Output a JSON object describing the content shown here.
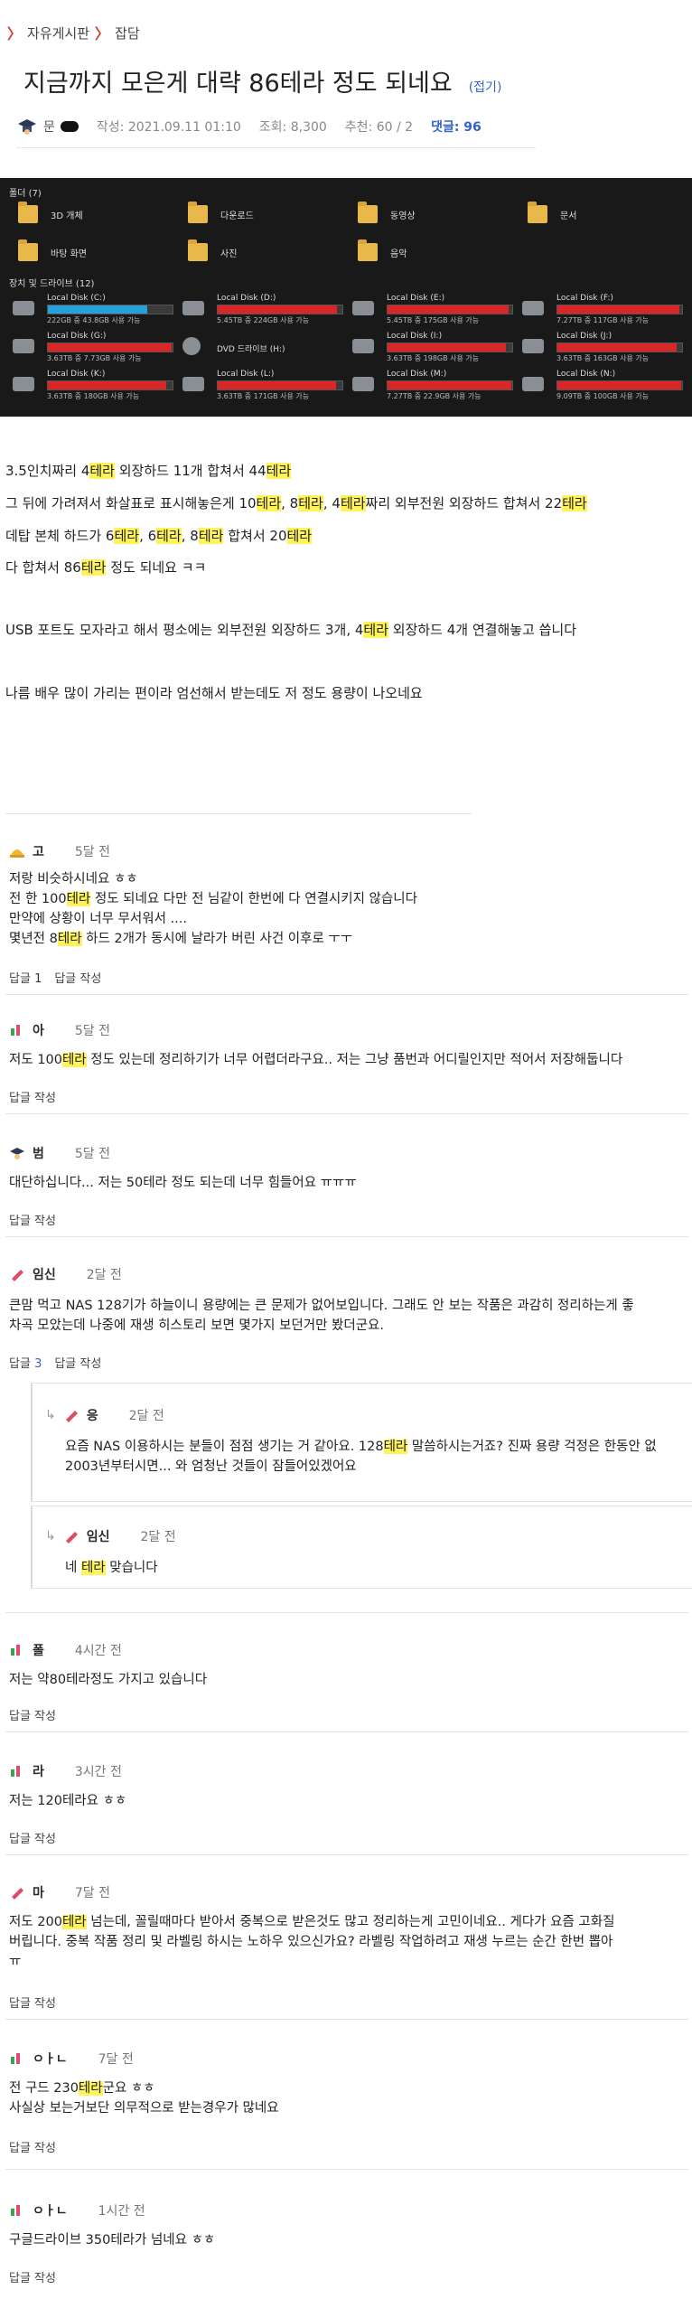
{
  "breadcrumb": {
    "board": "자유게시판",
    "category": "잡담"
  },
  "post": {
    "title": "지금까지 모은게 대략 86테라 정도 되네요",
    "fold_label": "(접기)",
    "author": "문",
    "date": "작성: 2021.09.11 01:10",
    "views": "조회: 8,300",
    "votes": "추천: 60 / 2",
    "comments": "댓글: 96"
  },
  "explorer": {
    "folders_header": "폴더 (7)",
    "folders": [
      "3D 개체",
      "다운로드",
      "동영상",
      "문서",
      "바탕 화면",
      "사진",
      "음악"
    ],
    "drives_header": "장치 및 드라이브 (12)",
    "drives": [
      {
        "name": "Local Disk (C:)",
        "space": "222GB 중 43.8GB 사용 가능",
        "used": 0.8,
        "color": "#26a0da"
      },
      {
        "name": "Local Disk (D:)",
        "space": "5.45TB 중 224GB 사용 가능",
        "used": 0.96,
        "color": "#da2626"
      },
      {
        "name": "Local Disk (E:)",
        "space": "5.45TB 중 175GB 사용 가능",
        "used": 0.97,
        "color": "#da2626"
      },
      {
        "name": "Local Disk (F:)",
        "space": "7.27TB 중 117GB 사용 가능",
        "used": 0.98,
        "color": "#da2626"
      },
      {
        "name": "Local Disk (G:)",
        "space": "3.63TB 중 7.73GB 사용 가능",
        "used": 0.99,
        "color": "#da2626"
      },
      {
        "name": "DVD 드라이브 (H:)",
        "space": "",
        "used": 0,
        "color": "#26a0da"
      },
      {
        "name": "Local Disk (I:)",
        "space": "3.63TB 중 198GB 사용 가능",
        "used": 0.95,
        "color": "#da2626"
      },
      {
        "name": "Local Disk (J:)",
        "space": "3.63TB 중 163GB 사용 가능",
        "used": 0.96,
        "color": "#da2626"
      },
      {
        "name": "Local Disk (K:)",
        "space": "3.63TB 중 180GB 사용 가능",
        "used": 0.95,
        "color": "#da2626"
      },
      {
        "name": "Local Disk (L:)",
        "space": "3.63TB 중 171GB 사용 가능",
        "used": 0.95,
        "color": "#da2626"
      },
      {
        "name": "Local Disk (M:)",
        "space": "7.27TB 중 22.9GB 사용 가능",
        "used": 0.99,
        "color": "#da2626"
      },
      {
        "name": "Local Disk (N:)",
        "space": "9.09TB 중 100GB 사용 가능",
        "used": 0.99,
        "color": "#da2626"
      }
    ]
  },
  "body": {
    "l1": [
      "3.5인치짜리 4",
      "테라",
      " 외장하드 11개 합쳐서 44",
      "테라"
    ],
    "l2": [
      "그 뒤에 가려져서 화살표로 표시해놓은게 10",
      "테라",
      ", 8",
      "테라",
      ", 4",
      "테라",
      "짜리 외부전원 외장하드 합쳐서 22",
      "테라"
    ],
    "l3": [
      "데탑 본체 하드가 6",
      "테라",
      ", 6",
      "테라",
      ", 8",
      "테라",
      " 합쳐서 20",
      "테라"
    ],
    "l4": [
      "다 합쳐서 86",
      "테라",
      " 정도 되네요 ㅋㅋ"
    ],
    "l5": [
      "USB 포트도 모자라고 해서 평소에는 외부전원 외장하드 3개, 4",
      "테라",
      " 외장하드 4개 연결해놓고 씁니다"
    ],
    "l6": "나름 배우 많이 가리는 편이라 엄선해서 받는데도 저 정도 용량이 나오네요"
  },
  "comments": [
    {
      "nick": "고",
      "time": "5달 전",
      "lines": [
        "저랑 비슷하시네요 ㅎㅎ",
        [
          "전 한 100",
          "테라",
          " 정도 되네요 다만 전 님같이 한번에 다 연결시키지 않습니다"
        ],
        "만약에 상황이 너무 무서워서 ....",
        [
          "몇년전 8",
          "테라",
          " 하드 2개가 동시에 날라가 버린 사건 이후로 ㅜㅜ"
        ]
      ],
      "reply_label": "답글",
      "reply_count": "1",
      "write_label": "답글 작성"
    },
    {
      "nick": "아",
      "time": "5달 전",
      "lines": [
        [
          "저도 100",
          "테라",
          " 정도 있는데 정리하기가 너무 어렵더라구요.. 저는 그냥 품번과 어디릴인지만 적어서 저장해둡니다"
        ]
      ],
      "write_label": "답글 작성"
    },
    {
      "nick": "범",
      "time": "5달 전",
      "lines": [
        "대단하십니다... 저는 50테라 정도 되는데 너무 힘들어요 ㅠㅠㅠ"
      ],
      "write_label": "답글 작성"
    },
    {
      "nick": "임신",
      "time": "2달 전",
      "lines": [
        "큰맘 먹고 NAS 128기가 하늘이니 용량에는 큰 문제가 없어보입니다. 그래도 안 보는 작품은 과감히 정리하는게 좋",
        "차곡 모았는데 나중에 재생 히스토리 보면 몇가지 보던거만 봤더군요."
      ],
      "reply_label": "답글",
      "reply_count": "3",
      "write_label": "답글 작성"
    },
    {
      "nick": "응",
      "time": "2달 전",
      "lines": [
        [
          "요즘 NAS 이용하시는 분들이 점점 생기는 거 같아요. 128",
          "테라",
          " 말씀하시는거죠? 진짜 용량 걱정은 한동안 없"
        ],
        "2003년부터시면... 와 엄청난 것들이 잠들어있겠어요"
      ]
    },
    {
      "nick": "임신",
      "time": "2달 전",
      "lines": [
        [
          "네 ",
          "테라",
          " 맞습니다"
        ]
      ]
    },
    {
      "nick": "폴",
      "time": "4시간 전",
      "lines": [
        "저는 약80테라정도 가지고 있습니다"
      ],
      "write_label": "답글 작성"
    },
    {
      "nick": "라",
      "time": "3시간 전",
      "lines": [
        "저는 120테라요 ㅎㅎ"
      ],
      "write_label": "답글 작성"
    },
    {
      "nick": "마",
      "time": "7달 전",
      "lines": [
        [
          "저도 200",
          "테라",
          " 넘는데, 꼴릴때마다 받아서 중복으로 받은것도 많고 정리하는게 고민이네요.. 게다가 요즘 고화질"
        ],
        "버립니다. 중복 작품 정리 및 라벨링 하시는 노하우 있으신가요? 라벨링 작업하려고 재생 누르는 순간 한번 뽑아",
        "ㅠ"
      ],
      "write_label": "답글 작성"
    },
    {
      "nick": "ㅇㅏㄴ",
      "time": "7달 전",
      "lines": [
        [
          "전 구드 230",
          "테라",
          "군요 ㅎㅎ"
        ],
        "사실상 보는거보단 의무적으로 받는경우가 많네요"
      ],
      "write_label": "답글 작성"
    },
    {
      "nick": "ㅇㅏㄴ",
      "time": "1시간 전",
      "lines": [
        "구글드라이브 350테라가 넘네요 ㅎㅎ"
      ],
      "write_label": "답글 작성"
    }
  ]
}
